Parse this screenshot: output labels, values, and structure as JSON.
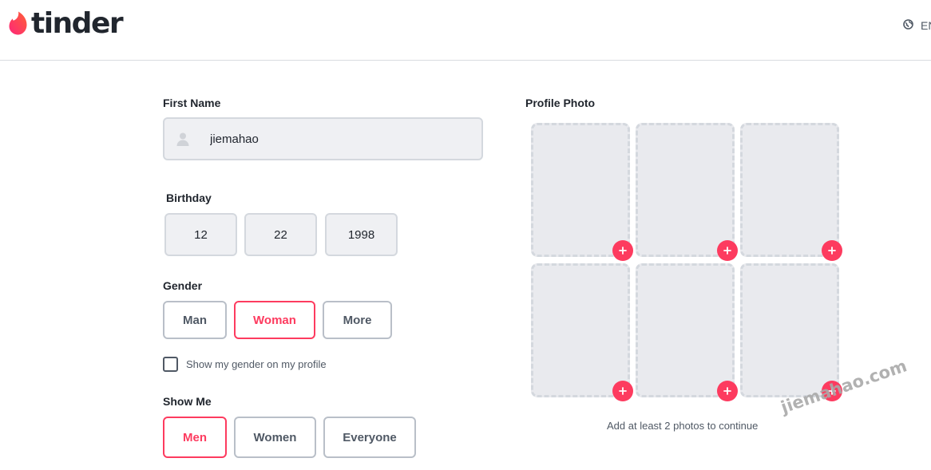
{
  "header": {
    "logo_text": "tinder",
    "language_label": "EN"
  },
  "form": {
    "first_name": {
      "label": "First Name",
      "value": "jiemahao"
    },
    "birthday": {
      "label": "Birthday",
      "month": "12",
      "day": "22",
      "year": "1998"
    },
    "gender": {
      "label": "Gender",
      "options": [
        "Man",
        "Woman",
        "More"
      ],
      "selected": "Woman",
      "show_on_profile_label": "Show my gender on my profile",
      "show_on_profile_checked": false
    },
    "show_me": {
      "label": "Show Me",
      "options": [
        "Men",
        "Women",
        "Everyone"
      ],
      "selected": "Men"
    }
  },
  "profile_photo": {
    "label": "Profile Photo",
    "slot_count": 6,
    "note": "Add at least 2 photos to continue"
  },
  "watermark": "jiemahao.com",
  "colors": {
    "accent": "#fd3b5f",
    "text_dark": "#21262e",
    "text_muted": "#505965",
    "field_bg": "#eff0f3",
    "slot_bg": "#e9eaee"
  },
  "icons": {
    "logo": "flame-icon",
    "language": "globe-icon",
    "name_field": "user-icon",
    "add_photo": "plus-icon"
  }
}
